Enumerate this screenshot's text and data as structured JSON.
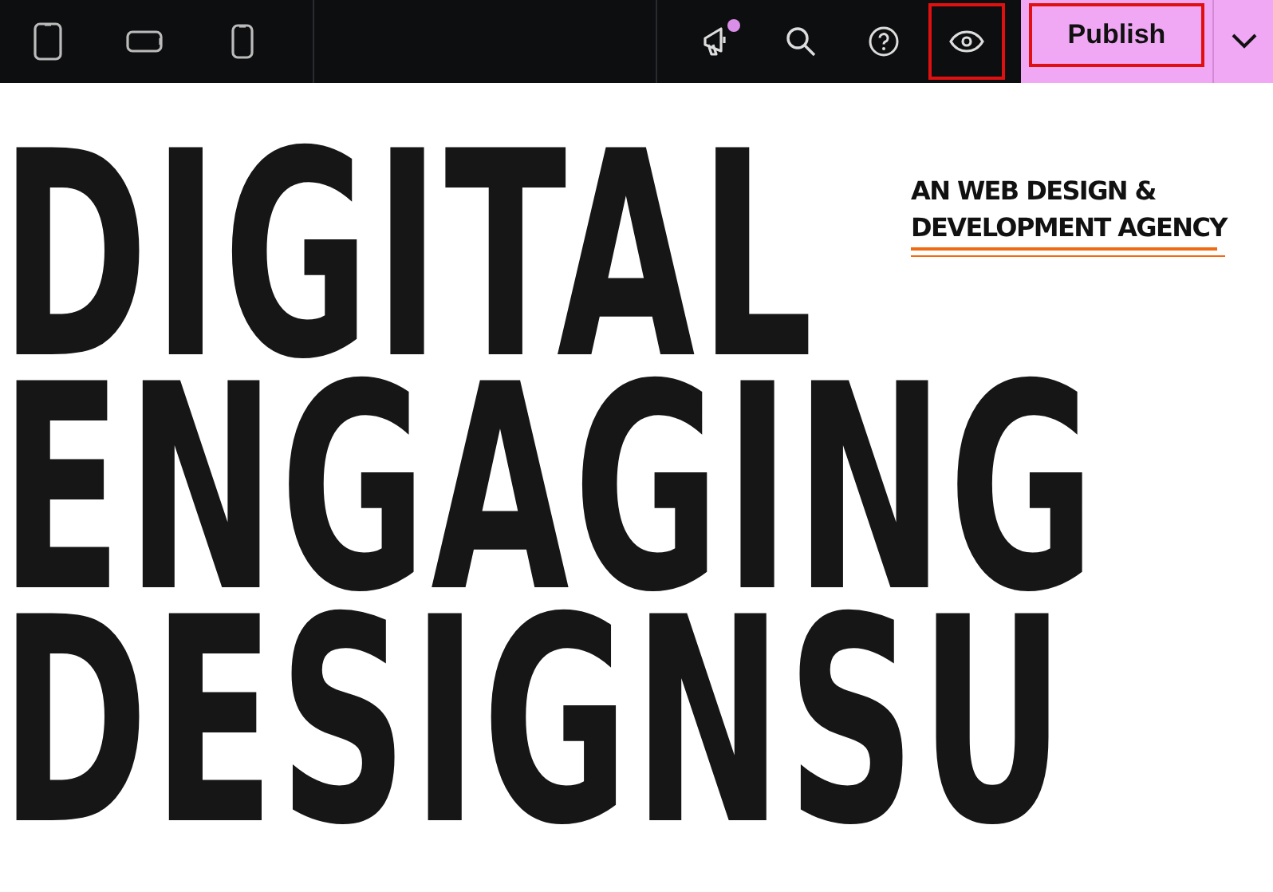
{
  "toolbar": {
    "devices": [
      {
        "kind": "tablet",
        "selected": false
      },
      {
        "kind": "landscape",
        "selected": false
      },
      {
        "kind": "phone",
        "selected": false
      }
    ],
    "tools": [
      {
        "kind": "announce",
        "badge": true,
        "highlighted": false
      },
      {
        "kind": "search",
        "badge": false,
        "highlighted": false
      },
      {
        "kind": "help",
        "badge": false,
        "highlighted": false
      },
      {
        "kind": "preview",
        "badge": false,
        "highlighted": true
      }
    ],
    "publish": {
      "label": "Publish",
      "highlighted": true
    }
  },
  "canvas": {
    "headline": [
      "DIGITAL",
      "ENGAGING",
      "DESIGNSU"
    ],
    "tagline": [
      "AN WEB DESIGN &",
      "DEVELOPMENT AGENCY"
    ]
  }
}
